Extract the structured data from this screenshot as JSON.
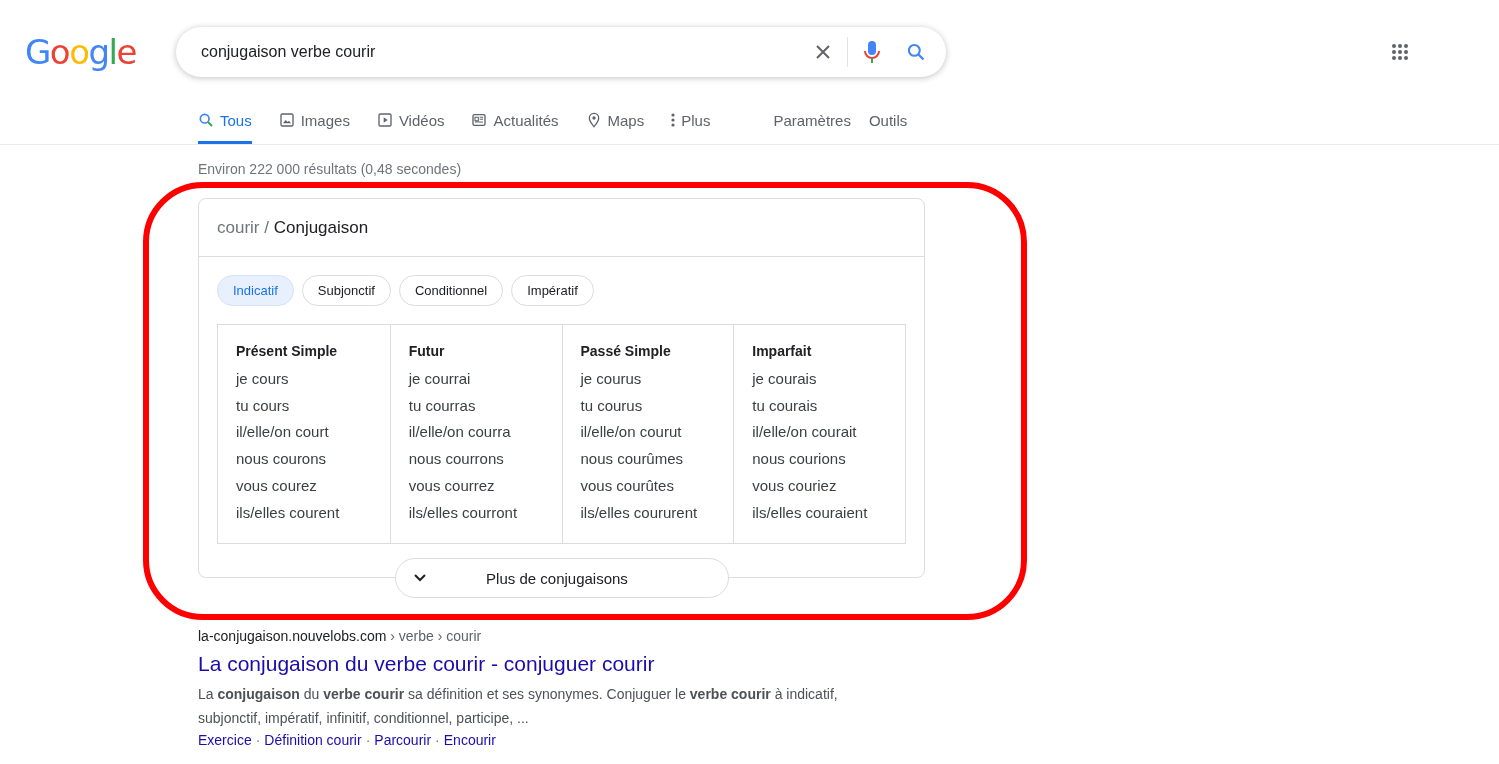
{
  "logo": "Google",
  "search": {
    "value": "conjugaison verbe courir"
  },
  "tabs": [
    {
      "label": "Tous",
      "kind": "all",
      "selected": true
    },
    {
      "label": "Images",
      "kind": "images",
      "selected": false
    },
    {
      "label": "Vidéos",
      "kind": "videos",
      "selected": false
    },
    {
      "label": "Actualités",
      "kind": "news",
      "selected": false
    },
    {
      "label": "Maps",
      "kind": "maps",
      "selected": false
    },
    {
      "label": "Plus",
      "kind": "more",
      "selected": false
    }
  ],
  "tools": [
    "Paramètres",
    "Outils"
  ],
  "result_stats": "Environ 222 000 résultats (0,48 secondes)",
  "conjugation_card": {
    "verb": "courir /",
    "title": "Conjugaison",
    "moods": [
      {
        "label": "Indicatif",
        "selected": true
      },
      {
        "label": "Subjonctif",
        "selected": false
      },
      {
        "label": "Conditionnel",
        "selected": false
      },
      {
        "label": "Impératif",
        "selected": false
      }
    ],
    "tenses": [
      {
        "name": "Présent Simple",
        "forms": [
          "je cours",
          "tu cours",
          "il/elle/on court",
          "nous courons",
          "vous courez",
          "ils/elles courent"
        ]
      },
      {
        "name": "Futur",
        "forms": [
          "je courrai",
          "tu courras",
          "il/elle/on courra",
          "nous courrons",
          "vous courrez",
          "ils/elles courront"
        ]
      },
      {
        "name": "Passé Simple",
        "forms": [
          "je courus",
          "tu courus",
          "il/elle/on courut",
          "nous courûmes",
          "vous courûtes",
          "ils/elles coururent"
        ]
      },
      {
        "name": "Imparfait",
        "forms": [
          "je courais",
          "tu courais",
          "il/elle/on courait",
          "nous courions",
          "vous couriez",
          "ils/elles couraient"
        ]
      }
    ],
    "more_button": "Plus de conjugaisons"
  },
  "result": {
    "domain": "la-conjugaison.nouvelobs.com",
    "path": "› verbe › courir",
    "title": "La conjugaison du verbe courir - conjuguer courir",
    "snippet": "La **conjugaison** du **verbe courir** sa définition et ses synonymes. Conjuguer le **verbe courir** à indicatif, subjonctif, impératif, infinitif, conditionnel, participe, ...",
    "sitelinks": [
      "Exercice",
      "Définition courir",
      "Parcourir",
      "Encourir"
    ],
    "separator": "·"
  }
}
